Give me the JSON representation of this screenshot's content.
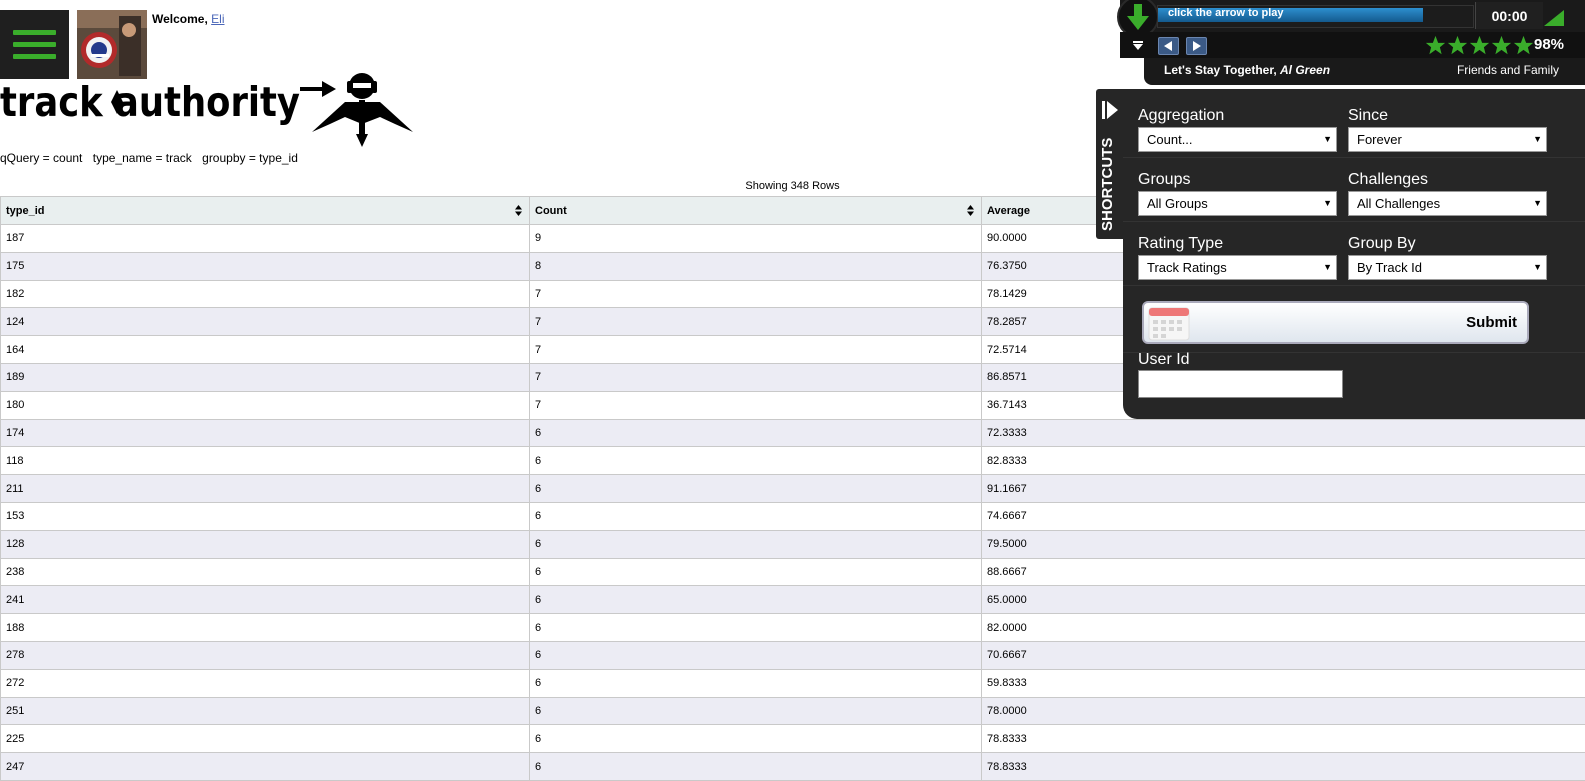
{
  "header": {
    "welcome_prefix": "Welcome,",
    "user_name": "Eli",
    "brand": "trackauthority"
  },
  "query": {
    "qquery": "qQuery = count",
    "type_name": "type_name = track",
    "groupby": "groupby = type_id"
  },
  "table": {
    "showing": "Showing 348 Rows",
    "columns": [
      "type_id",
      "Count",
      "Average"
    ],
    "rows": [
      [
        "187",
        "9",
        "90.0000"
      ],
      [
        "175",
        "8",
        "76.3750"
      ],
      [
        "182",
        "7",
        "78.1429"
      ],
      [
        "124",
        "7",
        "78.2857"
      ],
      [
        "164",
        "7",
        "72.5714"
      ],
      [
        "189",
        "7",
        "86.8571"
      ],
      [
        "180",
        "7",
        "36.7143"
      ],
      [
        "174",
        "6",
        "72.3333"
      ],
      [
        "118",
        "6",
        "82.8333"
      ],
      [
        "211",
        "6",
        "91.1667"
      ],
      [
        "153",
        "6",
        "74.6667"
      ],
      [
        "128",
        "6",
        "79.5000"
      ],
      [
        "238",
        "6",
        "88.6667"
      ],
      [
        "241",
        "6",
        "65.0000"
      ],
      [
        "188",
        "6",
        "82.0000"
      ],
      [
        "278",
        "6",
        "70.6667"
      ],
      [
        "272",
        "6",
        "59.8333"
      ],
      [
        "251",
        "6",
        "78.0000"
      ],
      [
        "225",
        "6",
        "78.8333"
      ],
      [
        "247",
        "6",
        "78.8333"
      ]
    ]
  },
  "player": {
    "progress_text": "click the arrow to play",
    "progress_fraction": 0.84,
    "time": "00:00",
    "rating_stars": 5,
    "rating_percent": "98%",
    "song_title": "Let's Stay Together,",
    "artist": "Al Green",
    "source": "Friends and Family",
    "accent": "#3aad2b"
  },
  "shortcuts": {
    "tab_label": "SHORTCUTS",
    "aggregation": {
      "label": "Aggregation",
      "value": "Count..."
    },
    "since": {
      "label": "Since",
      "value": "Forever"
    },
    "groups": {
      "label": "Groups",
      "value": "All Groups"
    },
    "challenges": {
      "label": "Challenges",
      "value": "All Challenges"
    },
    "rating_type": {
      "label": "Rating Type",
      "value": "Track Ratings"
    },
    "group_by": {
      "label": "Group By",
      "value": "By Track Id"
    },
    "submit": "Submit",
    "user_id": {
      "label": "User Id",
      "value": ""
    }
  }
}
